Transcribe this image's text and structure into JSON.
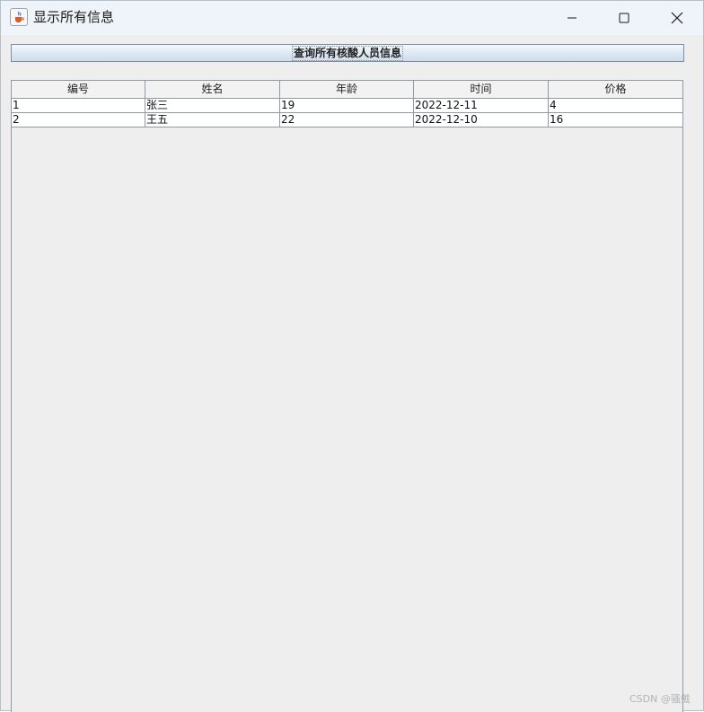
{
  "window": {
    "title": "显示所有信息",
    "icon": "java-cup-icon"
  },
  "toolbar": {
    "query_label": "查询所有核酸人员信息"
  },
  "table": {
    "columns": [
      "编号",
      "姓名",
      "年龄",
      "时间",
      "价格"
    ],
    "rows": [
      [
        "1",
        "张三",
        "19",
        "2022-12-11",
        "4"
      ],
      [
        "2",
        "王五",
        "22",
        "2022-12-10",
        "16"
      ]
    ]
  },
  "watermark": "CSDN @骚戴"
}
